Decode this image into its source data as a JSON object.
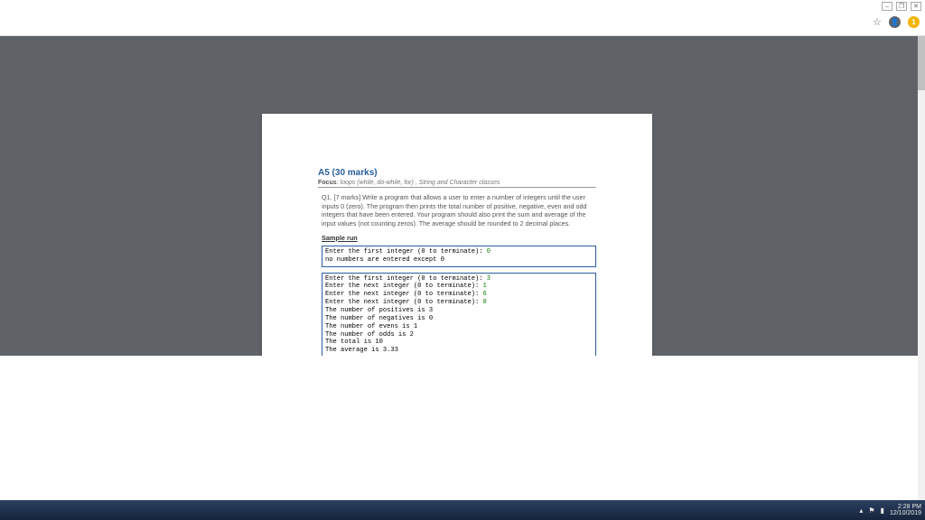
{
  "browser": {
    "star_glyph": "☆",
    "person_glyph": "👤",
    "notif_count": "1",
    "win_min": "–",
    "win_max": "❐",
    "win_close": "✕"
  },
  "doc": {
    "title": "A5 (30 marks)",
    "focus_label": "Focus",
    "focus_text": ": loops (while, do-while, for) , String and Character classes",
    "q1": "Q1. [7 marks] Write a program that allows a user to enter a number of integers until the user inputs 0 (zero). The program then prints the total number of positive, negative, even and odd integers that have been entered. Your program should also print the sum and average of the input values (not counting zeros). The average should be rounded to 2 decimal places.",
    "sample_run_label": "Sample run",
    "box1": {
      "l1a": "Enter the first integer (0 to terminate): ",
      "l1b": "0",
      "l2": "no numbers are entered except 0"
    },
    "box2": {
      "l1a": "Enter the first integer (0 to terminate): ",
      "l1b": "3",
      "l2a": "Enter the next integer (0 to terminate): ",
      "l2b": "1",
      "l3a": "Enter the next integer (0 to terminate): ",
      "l3b": "6",
      "l4a": "Enter the next integer (0 to terminate): ",
      "l4b": "0",
      "l5": "The number of positives is 3",
      "l6": "The number of negatives is 0",
      "l7": "The number of evens is 1",
      "l8": "The number of odds is 2",
      "l9": "The total is 10",
      "l10": "The average is 3.33"
    }
  },
  "taskbar": {
    "up_glyph": "▴",
    "flag_glyph": "⚑",
    "batt_glyph": "▮",
    "time": "2:28 PM",
    "date": "12/10/2019"
  }
}
